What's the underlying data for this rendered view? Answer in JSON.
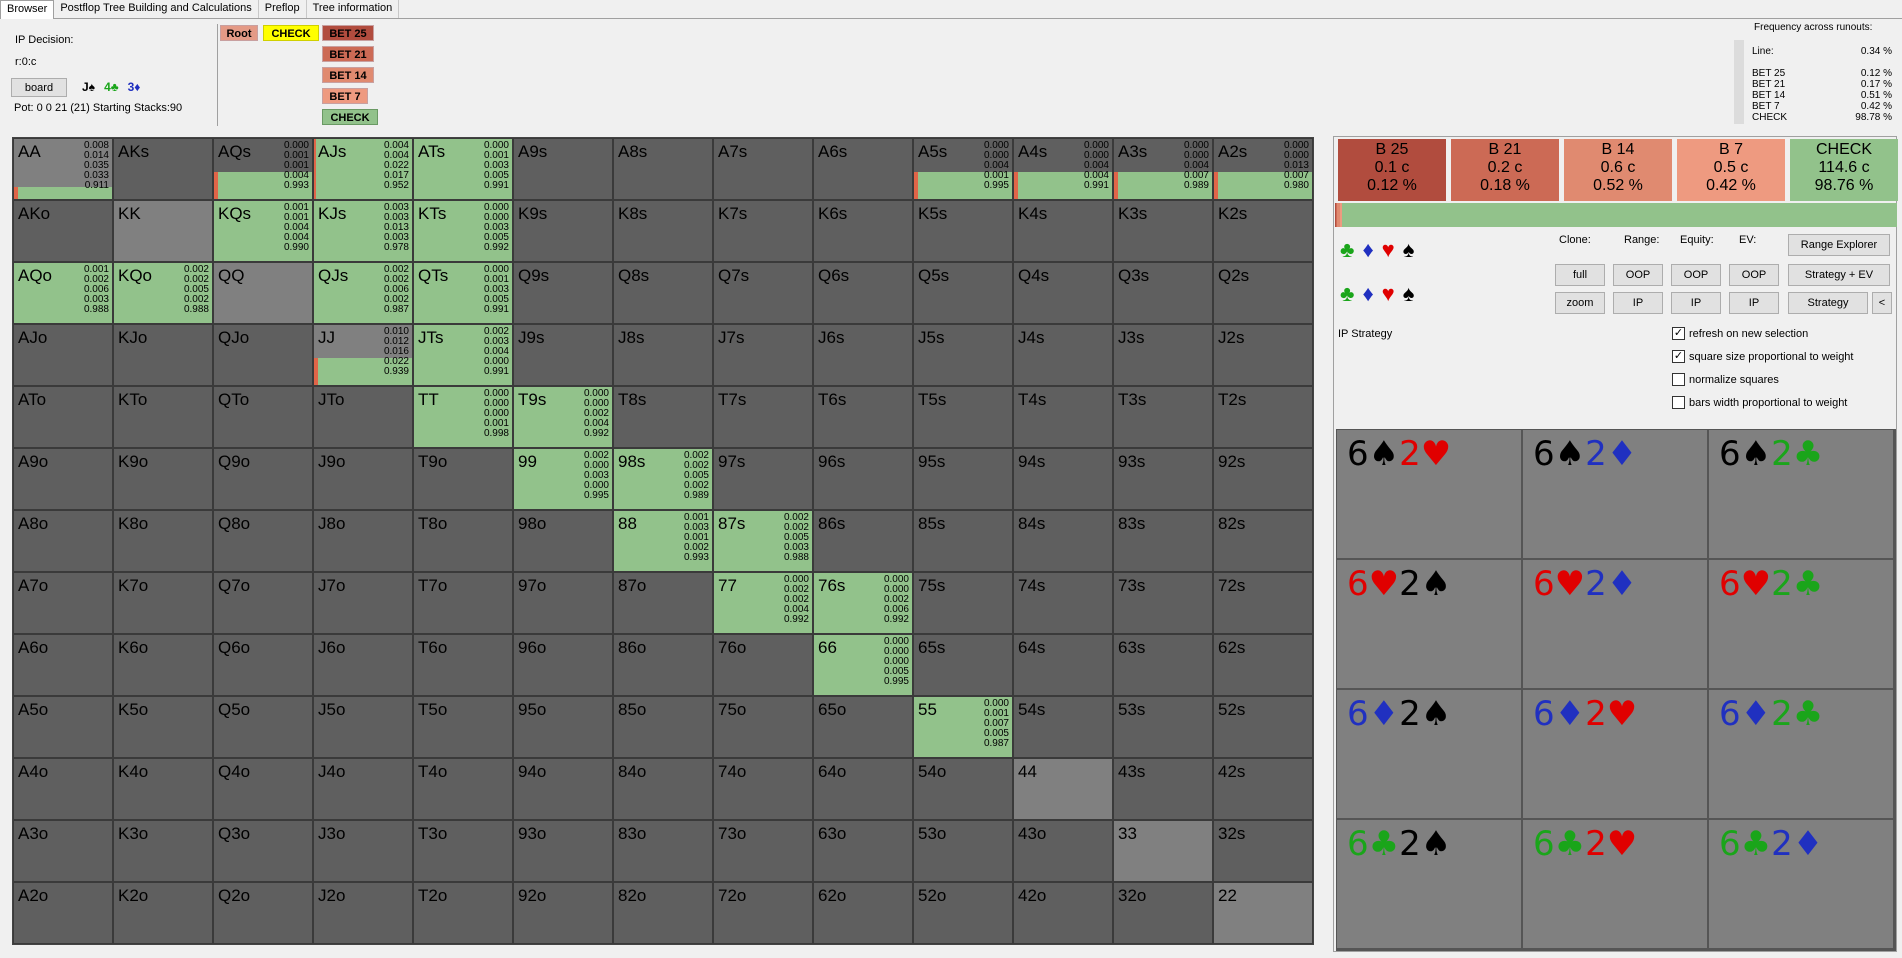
{
  "tabs": [
    "Browser",
    "Postflop Tree Building and Calculations",
    "Preflop",
    "Tree information"
  ],
  "header": {
    "ip_decision": "IP Decision:",
    "node_id": "r:0:c",
    "board_button": "board",
    "board_cards": [
      {
        "text": "J♠",
        "color": "#000000"
      },
      {
        "text": "4♣",
        "color": "#1aa51a"
      },
      {
        "text": "3♦",
        "color": "#2030c0"
      }
    ],
    "pot_line": "Pot: 0 0 21 (21) Starting Stacks:90"
  },
  "tree": {
    "root": "Root",
    "check": "CHECK",
    "children": [
      "BET 25",
      "BET 21",
      "BET 14",
      "BET 7",
      "CHECK"
    ]
  },
  "frequency": {
    "title": "Frequency across runouts:",
    "rows": [
      {
        "label": "Line:",
        "value": "0.34 %"
      },
      {
        "label": "BET 25",
        "value": "0.12 %"
      },
      {
        "label": "BET 21",
        "value": "0.17 %"
      },
      {
        "label": "BET 14",
        "value": "0.51 %"
      },
      {
        "label": "BET 7",
        "value": "0.42 %"
      },
      {
        "label": "CHECK",
        "value": "98.78 %"
      }
    ]
  },
  "grid": {
    "labels": [
      [
        "AA",
        "AKs",
        "AQs",
        "AJs",
        "ATs",
        "A9s",
        "A8s",
        "A7s",
        "A6s",
        "A5s",
        "A4s",
        "A3s",
        "A2s"
      ],
      [
        "AKo",
        "KK",
        "KQs",
        "KJs",
        "KTs",
        "K9s",
        "K8s",
        "K7s",
        "K6s",
        "K5s",
        "K4s",
        "K3s",
        "K2s"
      ],
      [
        "AQo",
        "KQo",
        "QQ",
        "QJs",
        "QTs",
        "Q9s",
        "Q8s",
        "Q7s",
        "Q6s",
        "Q5s",
        "Q4s",
        "Q3s",
        "Q2s"
      ],
      [
        "AJo",
        "KJo",
        "QJo",
        "JJ",
        "JTs",
        "J9s",
        "J8s",
        "J7s",
        "J6s",
        "J5s",
        "J4s",
        "J3s",
        "J2s"
      ],
      [
        "ATo",
        "KTo",
        "QTo",
        "JTo",
        "TT",
        "T9s",
        "T8s",
        "T7s",
        "T6s",
        "T5s",
        "T4s",
        "T3s",
        "T2s"
      ],
      [
        "A9o",
        "K9o",
        "Q9o",
        "J9o",
        "T9o",
        "99",
        "98s",
        "97s",
        "96s",
        "95s",
        "94s",
        "93s",
        "92s"
      ],
      [
        "A8o",
        "K8o",
        "Q8o",
        "J8o",
        "T8o",
        "98o",
        "88",
        "87s",
        "86s",
        "85s",
        "84s",
        "83s",
        "82s"
      ],
      [
        "A7o",
        "K7o",
        "Q7o",
        "J7o",
        "T7o",
        "97o",
        "87o",
        "77",
        "76s",
        "75s",
        "74s",
        "73s",
        "72s"
      ],
      [
        "A6o",
        "K6o",
        "Q6o",
        "J6o",
        "T6o",
        "96o",
        "86o",
        "76o",
        "66",
        "65s",
        "64s",
        "63s",
        "62s"
      ],
      [
        "A5o",
        "K5o",
        "Q5o",
        "J5o",
        "T5o",
        "95o",
        "85o",
        "75o",
        "65o",
        "55",
        "54s",
        "53s",
        "52s"
      ],
      [
        "A4o",
        "K4o",
        "Q4o",
        "J4o",
        "T4o",
        "94o",
        "84o",
        "74o",
        "64o",
        "54o",
        "44",
        "43s",
        "42s"
      ],
      [
        "A3o",
        "K3o",
        "Q3o",
        "J3o",
        "T3o",
        "93o",
        "83o",
        "73o",
        "63o",
        "53o",
        "43o",
        "33",
        "32s"
      ],
      [
        "A2o",
        "K2o",
        "Q2o",
        "J2o",
        "T2o",
        "92o",
        "82o",
        "72o",
        "62o",
        "52o",
        "42o",
        "32o",
        "22"
      ]
    ],
    "hands": {
      "AA": {
        "vals": [
          "0.008",
          "0.014",
          "0.035",
          "0.033",
          "0.911"
        ],
        "fill": 0.2,
        "range": 1
      },
      "AQs": {
        "vals": [
          "0.000",
          "0.001",
          "0.001",
          "0.004",
          "0.993"
        ],
        "fill": 0.45
      },
      "AJs": {
        "vals": [
          "0.004",
          "0.004",
          "0.022",
          "0.017",
          "0.952"
        ],
        "fill": 1
      },
      "ATs": {
        "vals": [
          "0.000",
          "0.001",
          "0.003",
          "0.005",
          "0.991"
        ],
        "fill": 1
      },
      "A5s": {
        "vals": [
          "0.000",
          "0.000",
          "0.004",
          "0.001",
          "0.995"
        ],
        "fill": 0.45
      },
      "A4s": {
        "vals": [
          "0.000",
          "0.000",
          "0.004",
          "0.004",
          "0.991"
        ],
        "fill": 0.45
      },
      "A3s": {
        "vals": [
          "0.000",
          "0.000",
          "0.004",
          "0.007",
          "0.989"
        ],
        "fill": 0.45
      },
      "A2s": {
        "vals": [
          "0.000",
          "0.000",
          "0.013",
          "0.007",
          "0.980"
        ],
        "fill": 0.45
      },
      "KQs": {
        "vals": [
          "0.001",
          "0.001",
          "0.004",
          "0.004",
          "0.990"
        ],
        "fill": 1
      },
      "KJs": {
        "vals": [
          "0.003",
          "0.003",
          "0.013",
          "0.003",
          "0.978"
        ],
        "fill": 1
      },
      "KTs": {
        "vals": [
          "0.000",
          "0.000",
          "0.003",
          "0.005",
          "0.992"
        ],
        "fill": 1
      },
      "AQo": {
        "vals": [
          "0.001",
          "0.002",
          "0.006",
          "0.003",
          "0.988"
        ],
        "fill": 1
      },
      "KQo": {
        "vals": [
          "0.002",
          "0.002",
          "0.005",
          "0.002",
          "0.988"
        ],
        "fill": 1
      },
      "QJs": {
        "vals": [
          "0.002",
          "0.002",
          "0.006",
          "0.002",
          "0.987"
        ],
        "fill": 1
      },
      "QTs": {
        "vals": [
          "0.000",
          "0.001",
          "0.003",
          "0.005",
          "0.991"
        ],
        "fill": 1
      },
      "JJ": {
        "vals": [
          "0.010",
          "0.012",
          "0.016",
          "0.022",
          "0.939"
        ],
        "fill": 0.45,
        "range": 1
      },
      "JTs": {
        "vals": [
          "0.002",
          "0.003",
          "0.004",
          "0.000",
          "0.991"
        ],
        "fill": 1
      },
      "TT": {
        "vals": [
          "0.000",
          "0.000",
          "0.000",
          "0.001",
          "0.998"
        ],
        "fill": 1
      },
      "T9s": {
        "vals": [
          "0.000",
          "0.000",
          "0.002",
          "0.004",
          "0.992"
        ],
        "fill": 1
      },
      "99": {
        "vals": [
          "0.002",
          "0.000",
          "0.003",
          "0.000",
          "0.995"
        ],
        "fill": 1
      },
      "98s": {
        "vals": [
          "0.002",
          "0.002",
          "0.005",
          "0.002",
          "0.989"
        ],
        "fill": 1
      },
      "88": {
        "vals": [
          "0.001",
          "0.003",
          "0.001",
          "0.002",
          "0.993"
        ],
        "fill": 1
      },
      "87s": {
        "vals": [
          "0.002",
          "0.002",
          "0.005",
          "0.003",
          "0.988"
        ],
        "fill": 1
      },
      "77": {
        "vals": [
          "0.000",
          "0.002",
          "0.002",
          "0.004",
          "0.992"
        ],
        "fill": 1
      },
      "76s": {
        "vals": [
          "0.000",
          "0.000",
          "0.002",
          "0.006",
          "0.992"
        ],
        "fill": 1
      },
      "66": {
        "vals": [
          "0.000",
          "0.000",
          "0.000",
          "0.005",
          "0.995"
        ],
        "fill": 1
      },
      "55": {
        "vals": [
          "0.000",
          "0.001",
          "0.007",
          "0.005",
          "0.987"
        ],
        "fill": 1
      },
      "KK": {
        "range": 1
      },
      "QQ": {
        "range": 1
      },
      "44": {
        "range": 1
      },
      "33": {
        "range": 1
      },
      "22": {
        "range": 1
      }
    }
  },
  "actions": [
    {
      "label": "B 25",
      "chips": "0.1 c",
      "pct": "0.12 %",
      "color": "#b14c3e"
    },
    {
      "label": "B 21",
      "chips": "0.2 c",
      "pct": "0.18 %",
      "color": "#cc6a55"
    },
    {
      "label": "B 14",
      "chips": "0.6 c",
      "pct": "0.52 %",
      "color": "#e08a70"
    },
    {
      "label": "B 7",
      "chips": "0.5 c",
      "pct": "0.42 %",
      "color": "#ee9a80"
    },
    {
      "label": "CHECK",
      "chips": "114.6 c",
      "pct": "98.76 %",
      "color": "#92c28b"
    }
  ],
  "strategy_bar": [
    0.12,
    0.18,
    0.52,
    0.42,
    98.76
  ],
  "controls": {
    "clone": "Clone:",
    "range": "Range:",
    "equity": "Equity:",
    "ev": "EV:",
    "full": "full",
    "zoom": "zoom",
    "oop1": "OOP",
    "ip1": "IP",
    "oop2": "OOP",
    "ip2": "IP",
    "oop3": "OOP",
    "ip3": "IP",
    "range_explorer": "Range Explorer",
    "strategy_ev": "Strategy + EV",
    "strategy": "Strategy",
    "back": "<",
    "ip_strategy": "IP Strategy",
    "chk_refresh": "refresh on new selection",
    "chk_square": "square size proportional to weight",
    "chk_normalize": "normalize squares",
    "chk_bars": "bars width proportional to weight"
  },
  "suits_row": [
    "♣",
    "♦",
    "♥",
    "♠"
  ],
  "suit_colors": {
    "c": "#1aa51a",
    "d": "#2030c0",
    "h": "#e00000",
    "s": "#000000"
  },
  "combos": [
    [
      {
        "t": "6",
        "s": "s"
      },
      {
        "t": "2",
        "s": "h"
      }
    ],
    [
      {
        "t": "6",
        "s": "s"
      },
      {
        "t": "2",
        "s": "d"
      }
    ],
    [
      {
        "t": "6",
        "s": "s"
      },
      {
        "t": "2",
        "s": "c"
      }
    ],
    [
      {
        "t": "6",
        "s": "h"
      },
      {
        "t": "2",
        "s": "s"
      }
    ],
    [
      {
        "t": "6",
        "s": "h"
      },
      {
        "t": "2",
        "s": "d"
      }
    ],
    [
      {
        "t": "6",
        "s": "h"
      },
      {
        "t": "2",
        "s": "c"
      }
    ],
    [
      {
        "t": "6",
        "s": "d"
      },
      {
        "t": "2",
        "s": "s"
      }
    ],
    [
      {
        "t": "6",
        "s": "d"
      },
      {
        "t": "2",
        "s": "h"
      }
    ],
    [
      {
        "t": "6",
        "s": "d"
      },
      {
        "t": "2",
        "s": "c"
      }
    ],
    [
      {
        "t": "6",
        "s": "c"
      },
      {
        "t": "2",
        "s": "s"
      }
    ],
    [
      {
        "t": "6",
        "s": "c"
      },
      {
        "t": "2",
        "s": "h"
      }
    ],
    [
      {
        "t": "6",
        "s": "c"
      },
      {
        "t": "2",
        "s": "d"
      }
    ]
  ]
}
